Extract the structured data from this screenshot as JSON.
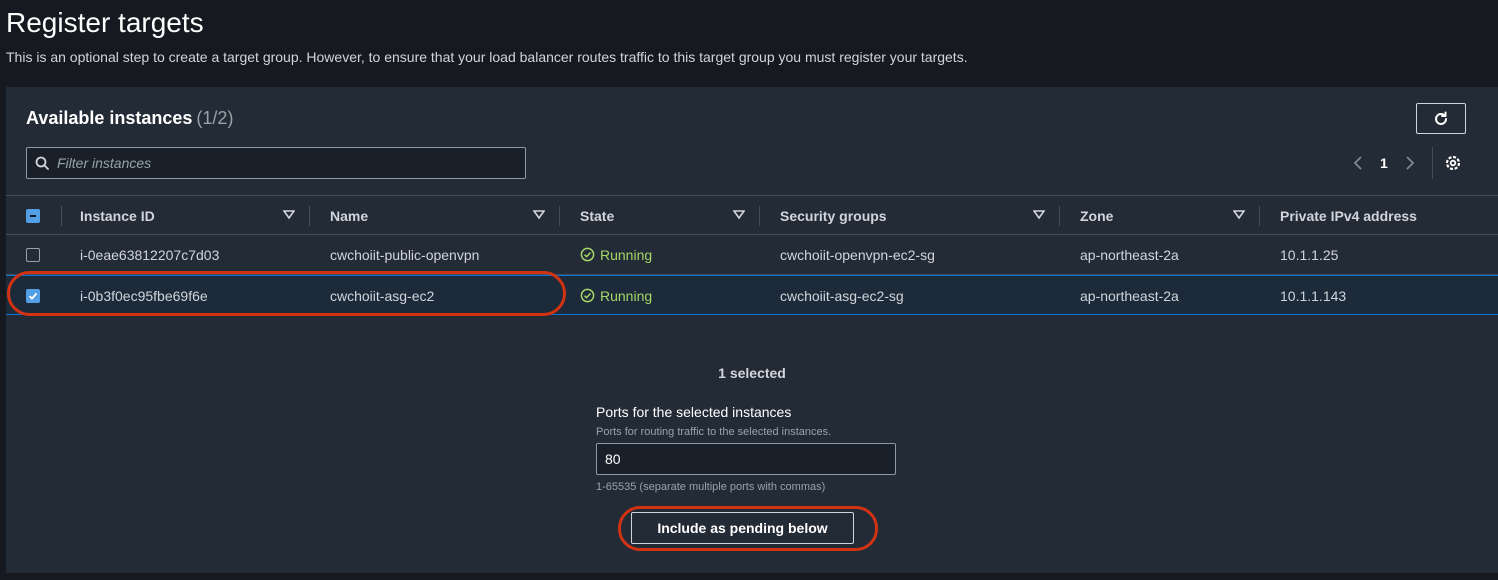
{
  "page": {
    "title": "Register targets",
    "description": "This is an optional step to create a target group. However, to ensure that your load balancer routes traffic to this target group you must register your targets."
  },
  "panel": {
    "title": "Available instances",
    "count": "(1/2)",
    "filter_placeholder": "Filter instances",
    "current_page": "1"
  },
  "table": {
    "columns": [
      "Instance ID",
      "Name",
      "State",
      "Security groups",
      "Zone",
      "Private IPv4 address"
    ],
    "rows": [
      {
        "selected": false,
        "instance_id": "i-0eae63812207c7d03",
        "name": "cwchoiit-public-openvpn",
        "state": "Running",
        "security_groups": "cwchoiit-openvpn-ec2-sg",
        "zone": "ap-northeast-2a",
        "ip": "10.1.1.25"
      },
      {
        "selected": true,
        "instance_id": "i-0b3f0ec95fbe69f6e",
        "name": "cwchoiit-asg-ec2",
        "state": "Running",
        "security_groups": "cwchoiit-asg-ec2-sg",
        "zone": "ap-northeast-2a",
        "ip": "10.1.1.143"
      }
    ]
  },
  "selection": {
    "summary": "1 selected",
    "ports_label": "Ports for the selected instances",
    "ports_hint": "Ports for routing traffic to the selected instances.",
    "ports_value": "80",
    "ports_constraint": "1-65535 (separate multiple ports with commas)",
    "include_button": "Include as pending below"
  },
  "colors": {
    "background": "#16191f",
    "panel": "#232b37",
    "running": "#a6d769",
    "checkbox": "#539fe5",
    "annotation": "#d13212"
  }
}
